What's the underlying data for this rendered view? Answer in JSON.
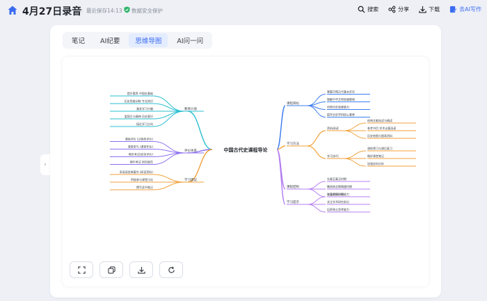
{
  "header": {
    "title": "4月27日录音",
    "save_status": "最近保存14:13",
    "security_label": "数据安全保护",
    "actions": [
      {
        "label": "搜索",
        "icon": "search-icon"
      },
      {
        "label": "分享",
        "icon": "share-icon"
      },
      {
        "label": "下载",
        "icon": "download-icon"
      },
      {
        "label": "去AI写作",
        "icon": "ai-write-icon"
      }
    ]
  },
  "tabs": [
    {
      "label": "笔记",
      "active": false
    },
    {
      "label": "AI纪要",
      "active": false
    },
    {
      "label": "思维导图",
      "active": true
    },
    {
      "label": "AI问一问",
      "active": false
    }
  ],
  "colors": {
    "accent": "#3b6cf0",
    "branch_teal": "#2bbfd1",
    "branch_purple": "#8c6ff0",
    "branch_orange": "#f0a23b",
    "branch_blue": "#3b7cf0",
    "branch_violet": "#b57ff0",
    "branch_amber": "#f0b040"
  },
  "mindmap": {
    "root": "中国古代史课程导论",
    "left": [
      {
        "label": "教育价值",
        "color": "teal",
        "children": [
          "提升素养  中国史基础",
          "历史思维训练  专业知识",
          "激发学习兴趣",
          "爱国主义精神  历史意识",
          "接近学习方向"
        ]
      },
      {
        "label": "评价体系",
        "color": "purple",
        "children": [
          "课程评价  (过程性评价)",
          "课堂参与  (课堂作业)",
          "期末考试(综合评价)",
          "期中考试  研究报告"
        ]
      },
      {
        "label": "学习建议",
        "color": "orange",
        "children": [
          "多阅读经典著作  (研读资料)",
          "积极参与课堂讨论",
          "撰写读书笔记"
        ]
      }
    ],
    "right": [
      {
        "label": "课程目标",
        "color": "blue",
        "children": [
          "掌握中国古代基本史实",
          "理解中华文明发展脉络",
          "培养历史思维能力",
          "提升历史学科核心素养"
        ]
      },
      {
        "label": "学习方法",
        "color": "orange",
        "children": [
          {
            "label": "资料阅读",
            "children": [
              "经典文献选读与精读",
              "参考书目  学术论著选读",
              "历史地图与图表资料"
            ]
          },
          {
            "label": "学习技巧",
            "children": [
              "课前预习与课后复习",
              "做好课堂笔记",
              "加强史料分析"
            ]
          }
        ]
      },
      {
        "label": "课程结构",
        "color": "violet",
        "children": [
          "先秦至秦汉时期",
          "魏晋南北朝隋唐时期",
          "宋元明清时期"
        ]
      },
      {
        "label": "学习提示",
        "color": "violet",
        "children": [
          "注重史料分析能力",
          "关注学术研究前沿",
          "培养独立思考能力"
        ]
      }
    ]
  },
  "toolbar": [
    {
      "name": "fit-screen-button",
      "icon": "fit-screen-icon"
    },
    {
      "name": "copy-button",
      "icon": "copy-icon"
    },
    {
      "name": "download-map-button",
      "icon": "download-icon"
    },
    {
      "name": "refresh-button",
      "icon": "refresh-icon"
    }
  ]
}
